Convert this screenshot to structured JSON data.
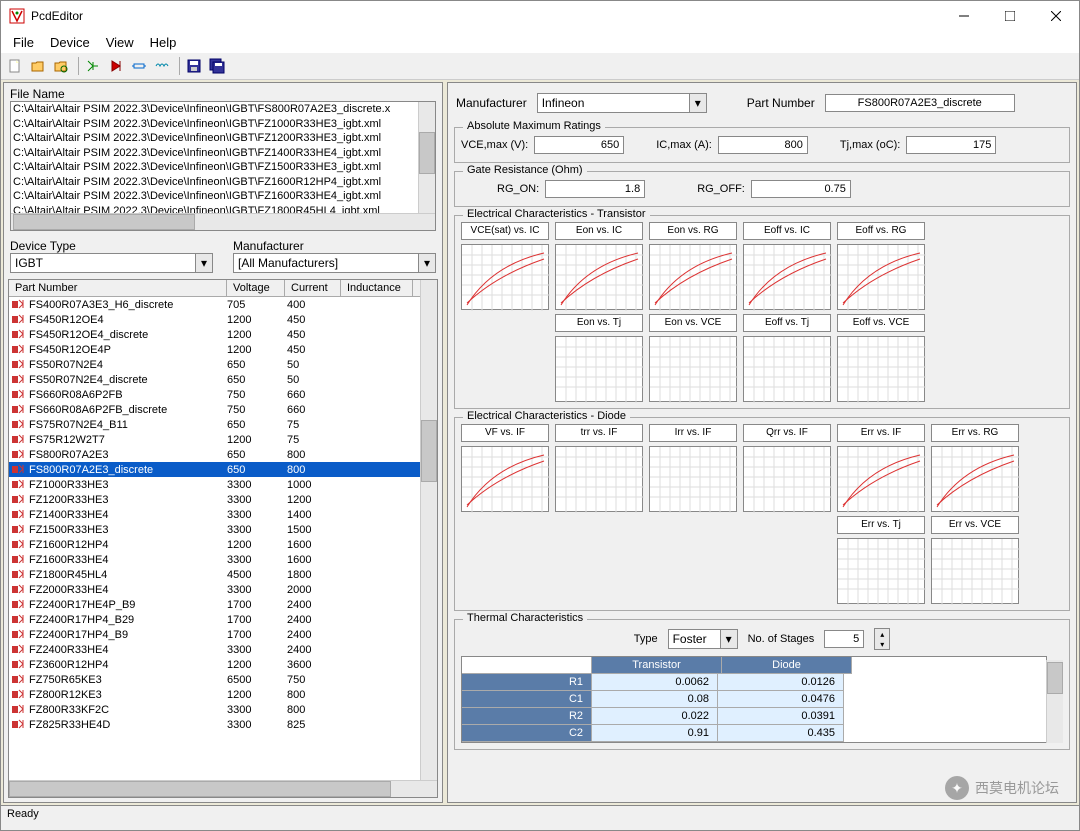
{
  "title": "PcdEditor",
  "menu": [
    "File",
    "Device",
    "View",
    "Help"
  ],
  "filelist_label": "File Name",
  "files": [
    "C:\\Altair\\Altair PSIM 2022.3\\Device\\Infineon\\IGBT\\FS800R07A2E3_discrete.x",
    "C:\\Altair\\Altair PSIM 2022.3\\Device\\Infineon\\IGBT\\FZ1000R33HE3_igbt.xml",
    "C:\\Altair\\Altair PSIM 2022.3\\Device\\Infineon\\IGBT\\FZ1200R33HE3_igbt.xml",
    "C:\\Altair\\Altair PSIM 2022.3\\Device\\Infineon\\IGBT\\FZ1400R33HE4_igbt.xml",
    "C:\\Altair\\Altair PSIM 2022.3\\Device\\Infineon\\IGBT\\FZ1500R33HE3_igbt.xml",
    "C:\\Altair\\Altair PSIM 2022.3\\Device\\Infineon\\IGBT\\FZ1600R12HP4_igbt.xml",
    "C:\\Altair\\Altair PSIM 2022.3\\Device\\Infineon\\IGBT\\FZ1600R33HE4_igbt.xml",
    "C:\\Altair\\Altair PSIM 2022.3\\Device\\Infineon\\IGBT\\FZ1800R45HL4_igbt.xml"
  ],
  "device_type_label": "Device Type",
  "device_type_value": "IGBT",
  "manufacturer_filter_label": "Manufacturer",
  "manufacturer_filter_value": "[All Manufacturers]",
  "part_columns": [
    "Part Number",
    "Voltage",
    "Current",
    "Inductance"
  ],
  "parts": [
    {
      "pn": "FS400R07A3E3_H6_discrete",
      "v": "705",
      "c": "400",
      "l": ""
    },
    {
      "pn": "FS450R12OE4",
      "v": "1200",
      "c": "450",
      "l": ""
    },
    {
      "pn": "FS450R12OE4_discrete",
      "v": "1200",
      "c": "450",
      "l": ""
    },
    {
      "pn": "FS450R12OE4P",
      "v": "1200",
      "c": "450",
      "l": ""
    },
    {
      "pn": "FS50R07N2E4",
      "v": "650",
      "c": "50",
      "l": ""
    },
    {
      "pn": "FS50R07N2E4_discrete",
      "v": "650",
      "c": "50",
      "l": ""
    },
    {
      "pn": "FS660R08A6P2FB",
      "v": "750",
      "c": "660",
      "l": ""
    },
    {
      "pn": "FS660R08A6P2FB_discrete",
      "v": "750",
      "c": "660",
      "l": ""
    },
    {
      "pn": "FS75R07N2E4_B11",
      "v": "650",
      "c": "75",
      "l": ""
    },
    {
      "pn": "FS75R12W2T7",
      "v": "1200",
      "c": "75",
      "l": ""
    },
    {
      "pn": "FS800R07A2E3",
      "v": "650",
      "c": "800",
      "l": ""
    },
    {
      "pn": "FS800R07A2E3_discrete",
      "v": "650",
      "c": "800",
      "l": "",
      "sel": true
    },
    {
      "pn": "FZ1000R33HE3",
      "v": "3300",
      "c": "1000",
      "l": ""
    },
    {
      "pn": "FZ1200R33HE3",
      "v": "3300",
      "c": "1200",
      "l": ""
    },
    {
      "pn": "FZ1400R33HE4",
      "v": "3300",
      "c": "1400",
      "l": ""
    },
    {
      "pn": "FZ1500R33HE3",
      "v": "3300",
      "c": "1500",
      "l": ""
    },
    {
      "pn": "FZ1600R12HP4",
      "v": "1200",
      "c": "1600",
      "l": ""
    },
    {
      "pn": "FZ1600R33HE4",
      "v": "3300",
      "c": "1600",
      "l": ""
    },
    {
      "pn": "FZ1800R45HL4",
      "v": "4500",
      "c": "1800",
      "l": ""
    },
    {
      "pn": "FZ2000R33HE4",
      "v": "3300",
      "c": "2000",
      "l": ""
    },
    {
      "pn": "FZ2400R17HE4P_B9",
      "v": "1700",
      "c": "2400",
      "l": ""
    },
    {
      "pn": "FZ2400R17HP4_B29",
      "v": "1700",
      "c": "2400",
      "l": ""
    },
    {
      "pn": "FZ2400R17HP4_B9",
      "v": "1700",
      "c": "2400",
      "l": ""
    },
    {
      "pn": "FZ2400R33HE4",
      "v": "3300",
      "c": "2400",
      "l": ""
    },
    {
      "pn": "FZ3600R12HP4",
      "v": "1200",
      "c": "3600",
      "l": ""
    },
    {
      "pn": "FZ750R65KE3",
      "v": "6500",
      "c": "750",
      "l": ""
    },
    {
      "pn": "FZ800R12KE3",
      "v": "1200",
      "c": "800",
      "l": ""
    },
    {
      "pn": "FZ800R33KF2C",
      "v": "3300",
      "c": "800",
      "l": ""
    },
    {
      "pn": "FZ825R33HE4D",
      "v": "3300",
      "c": "825",
      "l": ""
    }
  ],
  "right": {
    "mfr_label": "Manufacturer",
    "mfr_value": "Infineon",
    "pn_label": "Part Number",
    "pn_value": "FS800R07A2E3_discrete",
    "abs_legend": "Absolute Maximum Ratings",
    "vce_label": "VCE,max (V):",
    "vce_value": "650",
    "ic_label": "IC,max (A):",
    "ic_value": "800",
    "tj_label": "Tj,max (oC):",
    "tj_value": "175",
    "gate_legend": "Gate Resistance (Ohm)",
    "rgon_label": "RG_ON:",
    "rgon_value": "1.8",
    "rgoff_label": "RG_OFF:",
    "rgoff_value": "0.75",
    "trans_legend": "Electrical Characteristics - Transistor",
    "trans_charts_top": [
      "VCE(sat) vs. IC",
      "Eon vs. IC",
      "Eon vs. RG",
      "Eoff vs. IC",
      "Eoff vs. RG"
    ],
    "trans_charts_bot": [
      "",
      "Eon vs. Tj",
      "Eon vs. VCE",
      "Eoff vs. Tj",
      "Eoff vs. VCE"
    ],
    "diode_legend": "Electrical Characteristics - Diode",
    "diode_charts_top": [
      "VF vs. IF",
      "trr vs. IF",
      "Irr vs. IF",
      "Qrr vs. IF",
      "Err vs. IF",
      "Err vs. RG"
    ],
    "diode_charts_bot": [
      "",
      "",
      "",
      "",
      "Err vs. Tj",
      "Err vs. VCE"
    ],
    "therm_legend": "Thermal Characteristics",
    "type_label": "Type",
    "type_value": "Foster",
    "stages_label": "No. of Stages",
    "stages_value": "5",
    "th_cols": [
      "",
      "Transistor",
      "Diode"
    ],
    "th_rows": [
      {
        "h": "R1",
        "t": "0.0062",
        "d": "0.0126"
      },
      {
        "h": "C1",
        "t": "0.08",
        "d": "0.0476"
      },
      {
        "h": "R2",
        "t": "0.022",
        "d": "0.0391"
      },
      {
        "h": "C2",
        "t": "0.91",
        "d": "0.435"
      }
    ]
  },
  "status": "Ready",
  "watermark": "西莫电机论坛"
}
